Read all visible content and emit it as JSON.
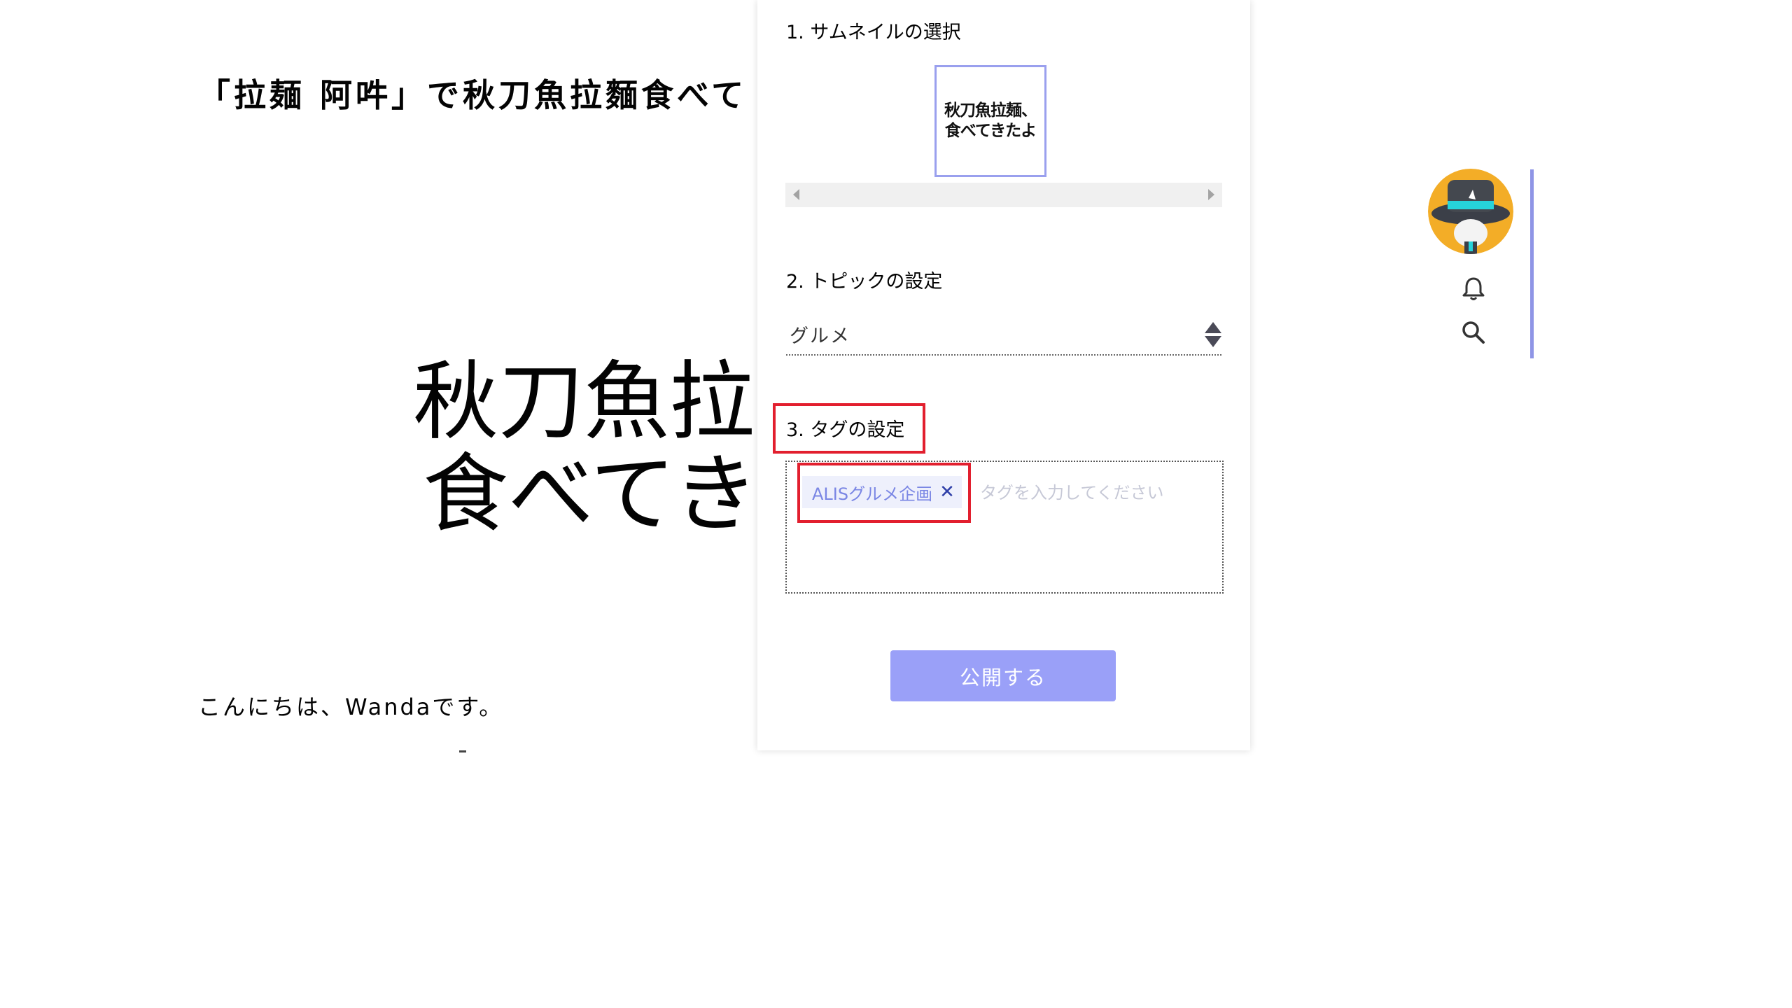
{
  "article": {
    "title": "「拉麺 阿吽」で秋刀魚拉麵食べて",
    "hero_line1": "秋刀魚拉",
    "hero_line2": "食べてきた",
    "greeting": "こんにちは、Wandaです。"
  },
  "panel": {
    "section1_title": "1. サムネイルの選択",
    "thumbnail_line1": "秋刀魚拉麺、",
    "thumbnail_line2": "食べてきたよ",
    "section2_title": "2. トピックの設定",
    "topic_value": "グルメ",
    "section3_title": "3. タグの設定",
    "tag_chip_label": "ALISグルメ企画",
    "tag_remove": "✕",
    "tag_placeholder": "タグを入力してください",
    "publish_label": "公開する"
  },
  "colors": {
    "accent": "#9aa0f8",
    "highlight": "#e21f2e",
    "rail": "#8f95e6"
  },
  "icons": {
    "notification": "bell-icon",
    "search": "search-icon"
  }
}
